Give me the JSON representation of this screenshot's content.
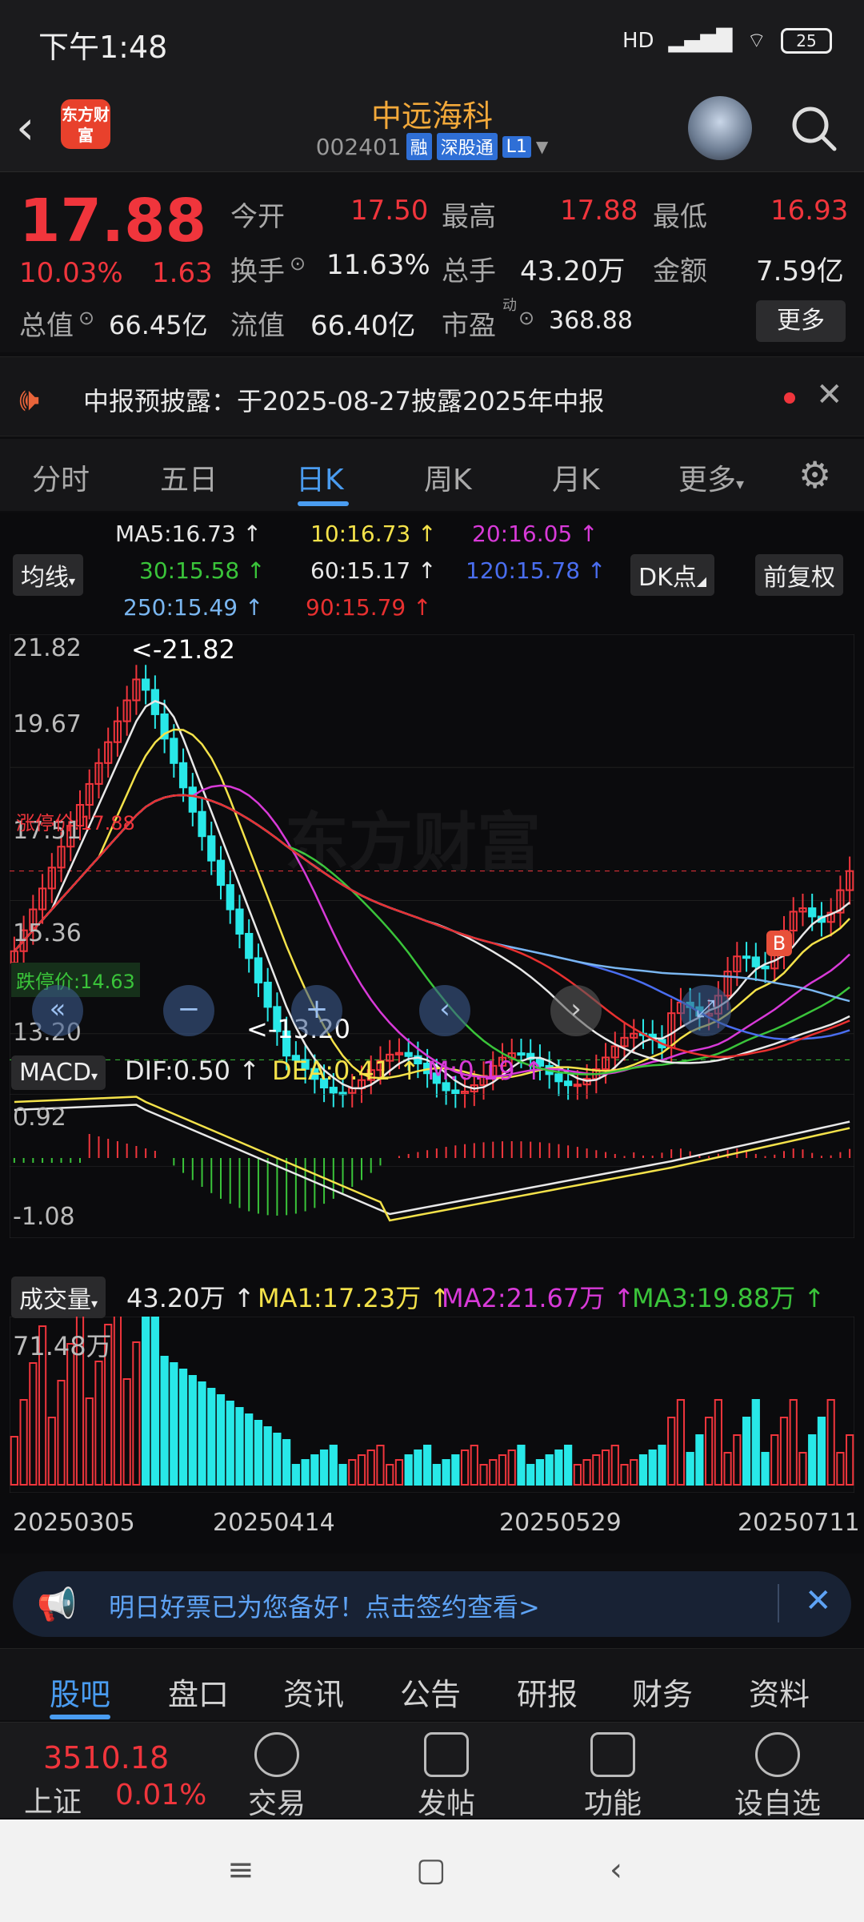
{
  "status": {
    "time": "下午1:48",
    "signal": "HD",
    "battery": "25"
  },
  "header": {
    "logo_text": "东方财富",
    "title": "中远海科",
    "code": "002401",
    "tags": [
      "融",
      "深股通",
      "L1"
    ]
  },
  "quote": {
    "price": "17.88",
    "change_pct": "10.03%",
    "change": "1.63",
    "open_label": "今开",
    "open": "17.50",
    "high_label": "最高",
    "high": "17.88",
    "low_label": "最低",
    "low": "16.93",
    "turnover_label": "换手",
    "turnover": "11.63%",
    "volume_label": "总手",
    "volume": "43.20万",
    "amount_label": "金额",
    "amount": "7.59亿",
    "mcap_label": "总值",
    "mcap": "66.45亿",
    "float_label": "流值",
    "float": "66.40亿",
    "pe_label": "市盈",
    "pe_sup": "动",
    "pe": "368.88",
    "more": "更多"
  },
  "notice": {
    "text": "中报预披露：于2025-08-27披露2025年中报"
  },
  "period_tabs": [
    "分时",
    "五日",
    "日K",
    "周K",
    "月K",
    "更多"
  ],
  "ma_row": {
    "ma5": "MA5:16.73",
    "ma10": "10:16.73",
    "ma20": "20:16.05",
    "ma30": "30:15.58",
    "ma60": "60:15.17",
    "ma120": "120:15.78",
    "ma250": "250:15.49",
    "ma90": "90:15.79",
    "type_btn": "均线",
    "dk_btn": "DK点",
    "fq_btn": "前复权"
  },
  "main_chart": {
    "y_ticks": [
      "21.82",
      "19.67",
      "17.51",
      "15.36",
      "13.20"
    ],
    "max_label": "<-21.82",
    "min_label": "<-13.20",
    "limit_up_label": "涨停价:17.88",
    "limit_down_label": "跌停价:14.63",
    "buy_mark": "B",
    "watermark": "东方财富"
  },
  "macd": {
    "btn": "MACD",
    "dif": "DIF:0.50",
    "dea": "DEA:0.41",
    "m": "M:0.19",
    "y_top": "0.92",
    "y_bottom": "-1.08"
  },
  "volume": {
    "btn": "成交量",
    "val": "43.20万",
    "ma1": "MA1:17.23万",
    "ma2": "MA2:21.67万",
    "ma3": "MA3:19.88万",
    "y_top": "71.48万"
  },
  "dates": [
    "20250305",
    "20250414",
    "20250529",
    "20250711"
  ],
  "ad": {
    "text": "明日好票已为您备好！点击签约查看>"
  },
  "bottom_tabs": [
    "股吧",
    "盘口",
    "资讯",
    "公告",
    "研报",
    "财务",
    "资料"
  ],
  "dock": {
    "index_value": "3510.18",
    "index_name": "上证",
    "index_pct": "0.01%",
    "items": [
      "交易",
      "发帖",
      "功能",
      "设自选"
    ]
  },
  "chart_data": {
    "type": "candlestick",
    "ylim": [
      13.2,
      21.82
    ],
    "max": 21.82,
    "min": 13.2,
    "last_close": 17.88,
    "limit_up": 17.88,
    "limit_down": 14.63,
    "ma": {
      "MA5": 16.73,
      "MA10": 16.73,
      "MA20": 16.05,
      "MA30": 15.58,
      "MA60": 15.17,
      "MA120": 15.78,
      "MA250": 15.49,
      "MA90": 15.79
    },
    "x_ticks": [
      "20250305",
      "20250414",
      "20250529",
      "20250711"
    ]
  }
}
